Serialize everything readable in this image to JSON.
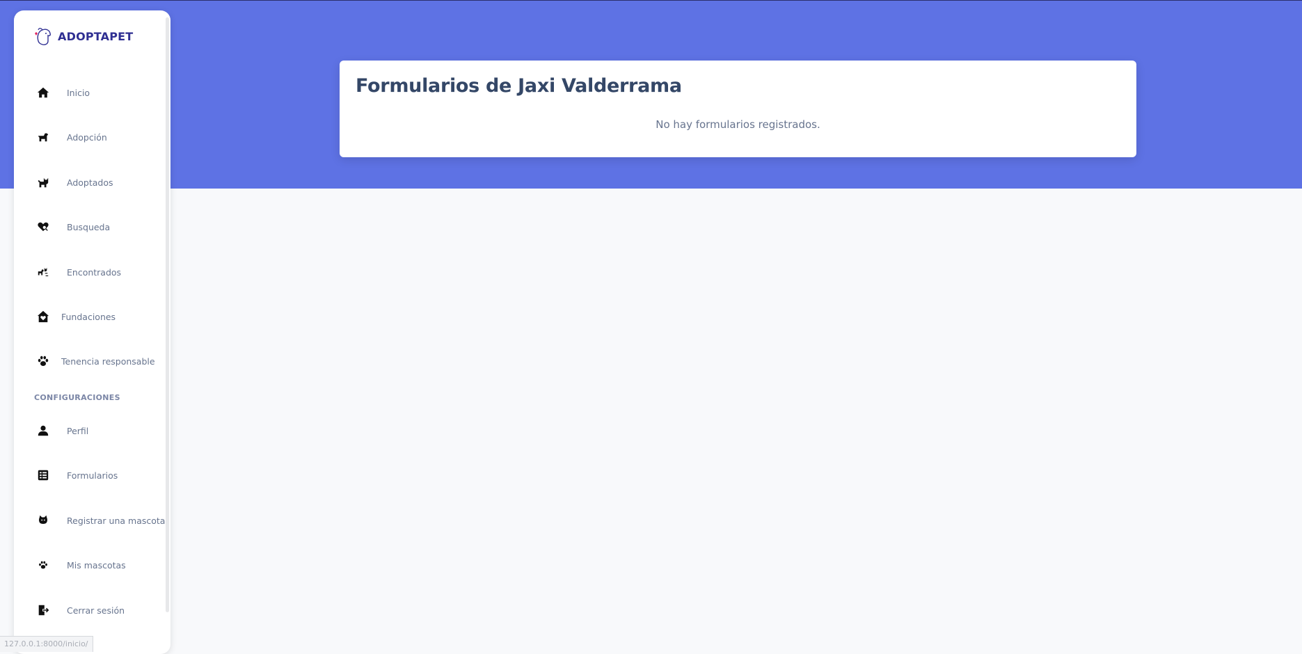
{
  "app": {
    "name": "ADOPTAPET"
  },
  "sidebar": {
    "items": [
      {
        "label": "Inicio",
        "icon": "home-icon"
      },
      {
        "label": "Adopción",
        "icon": "dog-icon"
      },
      {
        "label": "Adoptados",
        "icon": "cat-icon"
      },
      {
        "label": "Busqueda",
        "icon": "heart-search-icon"
      },
      {
        "label": "Encontrados",
        "icon": "dog-cat-icon"
      },
      {
        "label": "Fundaciones",
        "icon": "house-heart-icon"
      },
      {
        "label": "Tenencia responsable",
        "icon": "paw-icon"
      }
    ],
    "section_title": "CONFIGURACIONES",
    "config_items": [
      {
        "label": "Perfil",
        "icon": "user-icon"
      },
      {
        "label": "Formularios",
        "icon": "form-icon"
      },
      {
        "label": "Registrar una mascota",
        "icon": "cat-face-icon"
      },
      {
        "label": "Mis mascotas",
        "icon": "paw-icon"
      },
      {
        "label": "Cerrar sesión",
        "icon": "logout-icon"
      }
    ]
  },
  "main": {
    "title": "Formularios de Jaxi Valderrama",
    "empty_message": "No hay formularios registrados."
  },
  "status_url": "127.0.0.1:8000/inicio/",
  "colors": {
    "accent": "#5e72e4",
    "brand": "#2f2f92",
    "text_muted": "#67748e",
    "heading": "#344767"
  }
}
